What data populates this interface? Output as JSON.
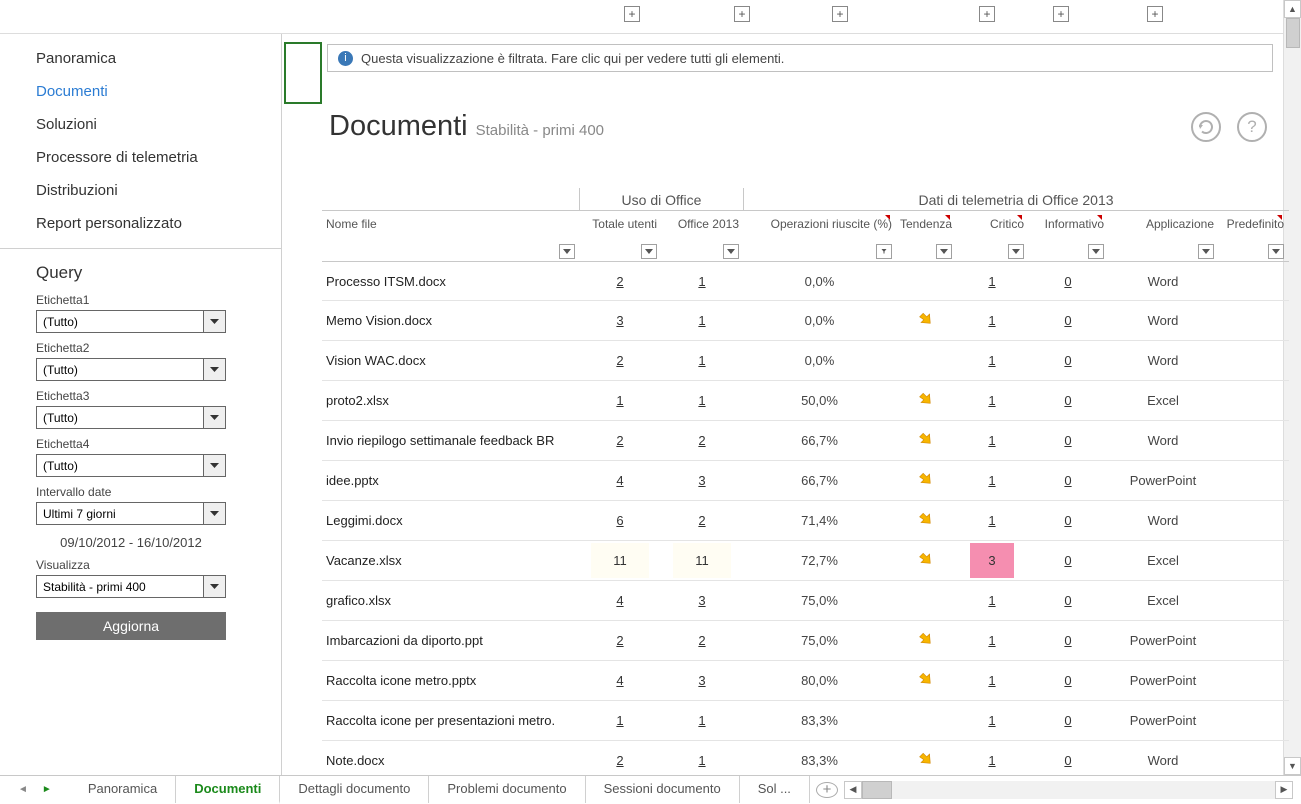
{
  "title": "Documenti",
  "subtitle": "Stabilità - primi 400",
  "info_bar": "Questa visualizzazione è filtrata. Fare clic qui per vedere tutti gli elementi.",
  "nav": [
    {
      "label": "Panoramica",
      "active": false
    },
    {
      "label": "Documenti",
      "active": true
    },
    {
      "label": "Soluzioni",
      "active": false
    },
    {
      "label": "Processore di telemetria",
      "active": false
    },
    {
      "label": "Distribuzioni",
      "active": false
    },
    {
      "label": "Report personalizzato",
      "active": false
    }
  ],
  "query": {
    "title": "Query",
    "labels": [
      "Etichetta1",
      "Etichetta2",
      "Etichetta3",
      "Etichetta4"
    ],
    "label_value": "(Tutto)",
    "date_label": "Intervallo date",
    "date_value": "Ultimi 7 giorni",
    "date_range": "09/10/2012 - 16/10/2012",
    "view_label": "Visualizza",
    "view_value": "Stabilità - primi 400",
    "update_btn": "Aggiorna"
  },
  "grid": {
    "group1": "Uso di Office",
    "group2": "Dati di telemetria di Office 2013",
    "cols": {
      "name": "Nome file",
      "total": "Totale utenti",
      "o2013": "Office 2013",
      "ops": "Operazioni riuscite (%)",
      "trend": "Tendenza",
      "crit": "Critico",
      "info": "Informativo",
      "app": "Applicazione",
      "pre": "Predefinito"
    },
    "rows": [
      {
        "name": "Processo ITSM.docx",
        "total": "2",
        "o2013": "1",
        "ops": "0,0%",
        "trend": false,
        "crit": "1",
        "info": "0",
        "app": "Word"
      },
      {
        "name": "Memo Vision.docx",
        "total": "3",
        "o2013": "1",
        "ops": "0,0%",
        "trend": true,
        "crit": "1",
        "info": "0",
        "app": "Word"
      },
      {
        "name": "Vision WAC.docx",
        "total": "2",
        "o2013": "1",
        "ops": "0,0%",
        "trend": false,
        "crit": "1",
        "info": "0",
        "app": "Word"
      },
      {
        "name": "proto2.xlsx",
        "total": "1",
        "o2013": "1",
        "ops": "50,0%",
        "trend": true,
        "crit": "1",
        "info": "0",
        "app": "Excel"
      },
      {
        "name": "Invio riepilogo settimanale feedback BR",
        "total": "2",
        "o2013": "2",
        "ops": "66,7%",
        "trend": true,
        "crit": "1",
        "info": "0",
        "app": "Word"
      },
      {
        "name": "idee.pptx",
        "total": "4",
        "o2013": "3",
        "ops": "66,7%",
        "trend": true,
        "crit": "1",
        "info": "0",
        "app": "PowerPoint"
      },
      {
        "name": "Leggimi.docx",
        "total": "6",
        "o2013": "2",
        "ops": "71,4%",
        "trend": true,
        "crit": "1",
        "info": "0",
        "app": "Word"
      },
      {
        "name": "Vacanze.xlsx",
        "total": "11",
        "o2013": "11",
        "ops": "72,7%",
        "trend": true,
        "crit": "3",
        "crit_hl": true,
        "info": "0",
        "app": "Excel",
        "lt": true
      },
      {
        "name": "grafico.xlsx",
        "total": "4",
        "o2013": "3",
        "ops": "75,0%",
        "trend": false,
        "crit": "1",
        "info": "0",
        "app": "Excel"
      },
      {
        "name": "Imbarcazioni da diporto.ppt",
        "total": "2",
        "o2013": "2",
        "ops": "75,0%",
        "trend": true,
        "crit": "1",
        "info": "0",
        "app": "PowerPoint"
      },
      {
        "name": "Raccolta icone metro.pptx",
        "total": "4",
        "o2013": "3",
        "ops": "80,0%",
        "trend": true,
        "crit": "1",
        "info": "0",
        "app": "PowerPoint"
      },
      {
        "name": "Raccolta icone per presentazioni metro.",
        "total": "1",
        "o2013": "1",
        "ops": "83,3%",
        "trend": false,
        "crit": "1",
        "info": "0",
        "app": "PowerPoint"
      },
      {
        "name": "Note.docx",
        "total": "2",
        "o2013": "1",
        "ops": "83,3%",
        "trend": true,
        "crit": "1",
        "info": "0",
        "app": "Word"
      }
    ]
  },
  "tabs": [
    {
      "label": "Panoramica",
      "active": false
    },
    {
      "label": "Documenti",
      "active": true
    },
    {
      "label": "Dettagli documento",
      "active": false
    },
    {
      "label": "Problemi documento",
      "active": false
    },
    {
      "label": "Sessioni documento",
      "active": false
    },
    {
      "label": "Sol ...",
      "active": false
    }
  ],
  "plus_positions": [
    624,
    734,
    832,
    979,
    1053,
    1147
  ]
}
